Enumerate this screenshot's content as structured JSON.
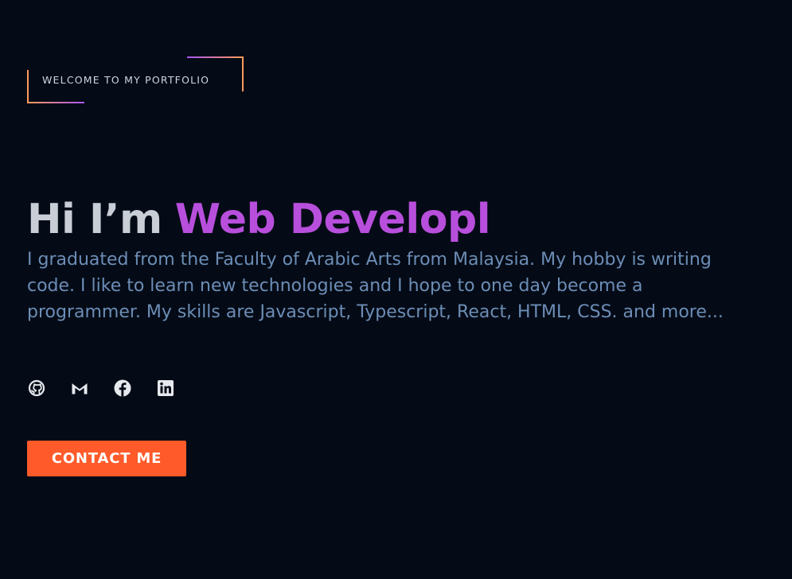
{
  "hero": {
    "badge": "WELCOME TO MY PORTFOLIO",
    "greeting": "Hi I’m",
    "role": "Web Developl",
    "description": "I graduated from the Faculty of Arabic Arts from Malaysia. My hobby is writing code. I like to learn new technologies and I hope to one day become a programmer. My skills are Javascript, Typescript, React, HTML, CSS. and more...",
    "contact_label": "CONTACT ME"
  },
  "socials": [
    {
      "icon": "github-icon"
    },
    {
      "icon": "gmail-icon"
    },
    {
      "icon": "facebook-icon"
    },
    {
      "icon": "linkedin-icon"
    }
  ],
  "colors": {
    "background": "#040b16",
    "accent_purple": "#b84fdc",
    "accent_orange": "#ff5a2a",
    "text_muted": "#6c8db6",
    "text_light": "#c9ced6"
  }
}
